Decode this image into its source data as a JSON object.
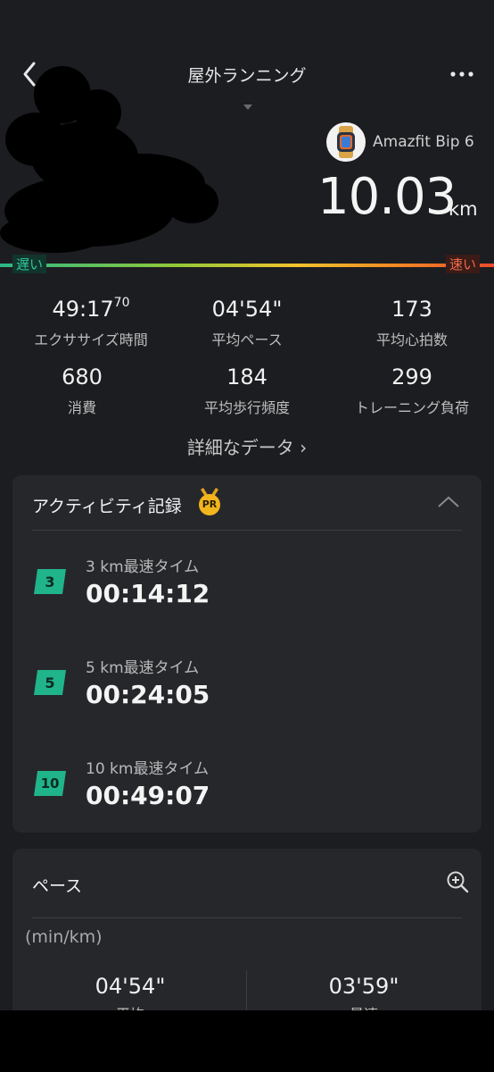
{
  "header": {
    "title": "屋外ランニング"
  },
  "device": {
    "name": "Amazfit Bip 6"
  },
  "summary": {
    "distance": "10.03",
    "distance_unit": "km"
  },
  "speed_bar": {
    "slow_label": "遅い",
    "fast_label": "速い"
  },
  "stats": [
    {
      "value": "49:17",
      "value_sup": "70",
      "label": "エクササイズ時間"
    },
    {
      "value": "04'54\"",
      "label": "平均ペース"
    },
    {
      "value": "173",
      "label": "平均心拍数"
    },
    {
      "value": "680",
      "label": "消費"
    },
    {
      "value": "184",
      "label": "平均歩行頻度"
    },
    {
      "value": "299",
      "label": "トレーニング負荷"
    }
  ],
  "details_link": "詳細なデータ ›",
  "activity_records": {
    "title": "アクティビティ記録",
    "pr_badge": "PR",
    "items": [
      {
        "badge": "3",
        "title": "3 km最速タイム",
        "time": "00:14:12"
      },
      {
        "badge": "5",
        "title": "5 km最速タイム",
        "time": "00:24:05"
      },
      {
        "badge": "10",
        "title": "10 km最速タイム",
        "time": "00:49:07"
      }
    ]
  },
  "pace": {
    "title": "ペース",
    "unit": "(min/km)",
    "avg_value": "04'54\"",
    "avg_label": "平均",
    "best_value": "03'59\"",
    "best_label": "最速"
  },
  "colors": {
    "accent_green": "#20b48a",
    "pr_gold": "#f2b51d",
    "bar_fast": "#ec4b2c"
  }
}
